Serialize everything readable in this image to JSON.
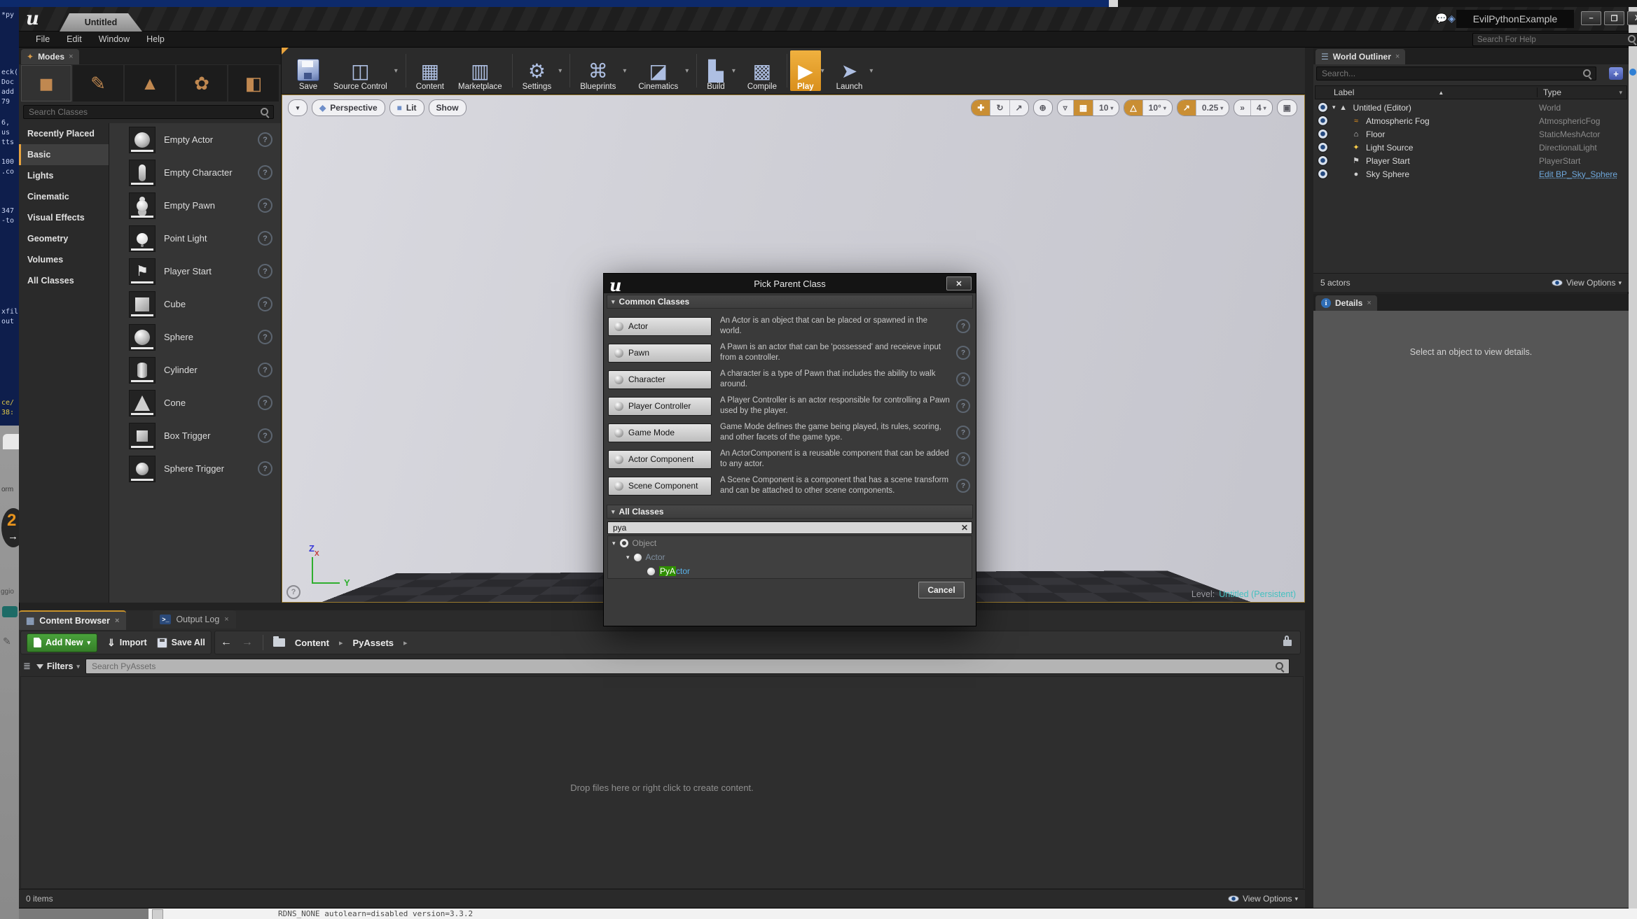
{
  "desktop": {
    "terminal_fragments": [
      "*py",
      "eck(",
      "Doc",
      "add",
      "79",
      "6,",
      "us",
      "tts",
      "100",
      ".co",
      "347",
      "-to",
      "xfil",
      "out",
      "ce/",
      "38:"
    ],
    "partials": {
      "orm": "orm",
      "ggio": "ggio",
      "badge": "2"
    },
    "bottom_text": "RDNS_NONE autolearn=disabled version=3.3.2"
  },
  "window": {
    "tab_title": "Untitled",
    "menu": [
      "File",
      "Edit",
      "Window",
      "Help"
    ],
    "title": "EvilPythonExample",
    "controls": {
      "minimize": "–",
      "maximize": "❐",
      "close": "X"
    },
    "help_search_placeholder": "Search For Help"
  },
  "toolbar": {
    "buttons": [
      "Save",
      "Source Control",
      "Content",
      "Marketplace",
      "Settings",
      "Blueprints",
      "Cinematics",
      "Build",
      "Compile",
      "Play",
      "Launch"
    ],
    "play_accent_color": "#e8a33d"
  },
  "modes": {
    "tab_label": "Modes",
    "search_placeholder": "Search Classes",
    "categories": [
      "Recently Placed",
      "Basic",
      "Lights",
      "Cinematic",
      "Visual Effects",
      "Geometry",
      "Volumes",
      "All Classes"
    ],
    "selected_category": "Basic",
    "items": [
      "Empty Actor",
      "Empty Character",
      "Empty Pawn",
      "Point Light",
      "Player Start",
      "Cube",
      "Sphere",
      "Cylinder",
      "Cone",
      "Box Trigger",
      "Sphere Trigger"
    ]
  },
  "viewport": {
    "perspective_label": "Perspective",
    "lit_label": "Lit",
    "show_label": "Show",
    "grid_snap_value": "10",
    "rotation_snap_value": "10°",
    "scale_snap_value": "0.25",
    "camera_speed_value": "4",
    "axis": {
      "z": "Z",
      "y": "Y",
      "x": "X"
    },
    "level_label": "Level:",
    "level_value": "Untitled (Persistent)",
    "level_value_color": "#45c0c0"
  },
  "dialog": {
    "title": "Pick Parent Class",
    "sections": {
      "common": "Common Classes",
      "all": "All Classes"
    },
    "classes": [
      {
        "label": "Actor",
        "desc": "An Actor is an object that can be placed or spawned in the world."
      },
      {
        "label": "Pawn",
        "desc": "A Pawn is an actor that can be 'possessed' and receieve input from a controller."
      },
      {
        "label": "Character",
        "desc": "A character is a type of Pawn that includes the ability to walk around."
      },
      {
        "label": "Player Controller",
        "desc": "A Player Controller is an actor responsible for controlling a Pawn used by the player."
      },
      {
        "label": "Game Mode",
        "desc": "Game Mode defines the game being played, its rules, scoring, and other facets of the game type."
      },
      {
        "label": "Actor Component",
        "desc": "An ActorComponent is a reusable component that can be added to any actor."
      },
      {
        "label": "Scene Component",
        "desc": "A Scene Component is a component that has a scene transform and can be attached to other scene components."
      }
    ],
    "search_value": "pya",
    "tree": {
      "root": "Object",
      "child": "Actor",
      "match": "PyA",
      "rest": "ctor",
      "match_color": "#2f8f00"
    },
    "cancel_label": "Cancel"
  },
  "outliner": {
    "tab_label": "World Outliner",
    "search_placeholder": "Search...",
    "col_label": "Label",
    "col_type": "Type",
    "rows": [
      {
        "label": "Untitled (Editor)",
        "type": "World"
      },
      {
        "label": "Atmospheric Fog",
        "type": "AtmosphericFog"
      },
      {
        "label": "Floor",
        "type": "StaticMeshActor"
      },
      {
        "label": "Light Source",
        "type": "DirectionalLight"
      },
      {
        "label": "Player Start",
        "type": "PlayerStart"
      },
      {
        "label": "Sky Sphere",
        "type": "Edit BP_Sky_Sphere"
      }
    ],
    "count": "5 actors",
    "view_options": "View Options"
  },
  "details": {
    "tab_label": "Details",
    "message": "Select an object to view details."
  },
  "content_browser": {
    "tab_label": "Content Browser",
    "output_log_label": "Output Log",
    "add_new": "Add New",
    "import_label": "Import",
    "save_all": "Save All",
    "crumb_root": "Content",
    "crumb_folder": "PyAssets",
    "filters_label": "Filters",
    "search_placeholder": "Search PyAssets",
    "empty_message": "Drop files here or right click to create content.",
    "count": "0 items",
    "view_options": "View Options"
  }
}
